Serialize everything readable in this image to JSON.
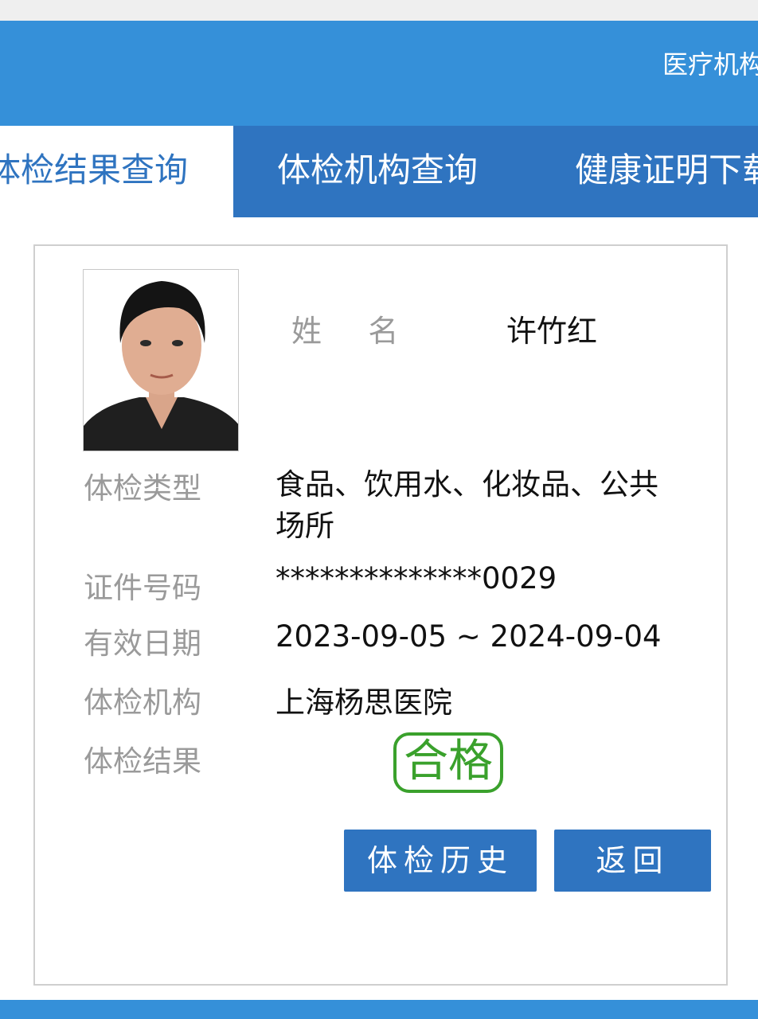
{
  "header": {
    "title": "医疗机构"
  },
  "tabs": [
    {
      "label": "体检结果查询",
      "active": true
    },
    {
      "label": "体检机构查询",
      "active": false
    },
    {
      "label": "健康证明下载",
      "active": false
    }
  ],
  "profile": {
    "name_label": "姓    名",
    "name_value": "许竹红",
    "fields": [
      {
        "label": "体检类型",
        "value": "食品、饮用水、化妆品、公共场所"
      },
      {
        "label": "证件号码",
        "value": "**************0029"
      },
      {
        "label": "有效日期",
        "value": "2023-09-05 ~ 2024-09-04"
      },
      {
        "label": "体检机构",
        "value": "上海杨思医院"
      },
      {
        "label": "体检结果",
        "value": "合格"
      }
    ]
  },
  "buttons": {
    "history": "体检历史",
    "back": "返回"
  },
  "colors": {
    "header_bg": "#3590d9",
    "tab_bg": "#2f74c0",
    "stamp": "#3aa12c"
  }
}
